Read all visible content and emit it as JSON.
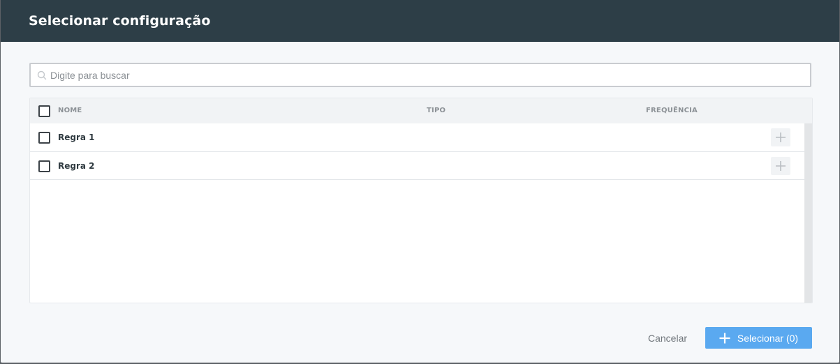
{
  "dialog": {
    "title": "Selecionar configuração"
  },
  "search": {
    "placeholder": "Digite para buscar",
    "value": ""
  },
  "table": {
    "columns": [
      "NOME",
      "TIPO",
      "FREQUÊNCIA"
    ],
    "rows": [
      {
        "name": "Regra 1",
        "tipo": "",
        "frequencia": ""
      },
      {
        "name": "Regra 2",
        "tipo": "",
        "frequencia": ""
      }
    ]
  },
  "footer": {
    "cancel_label": "Cancelar",
    "select_label": "Selecionar (0)"
  },
  "colors": {
    "header_bg": "#2d3e47",
    "primary_button": "#5aa9f0"
  }
}
